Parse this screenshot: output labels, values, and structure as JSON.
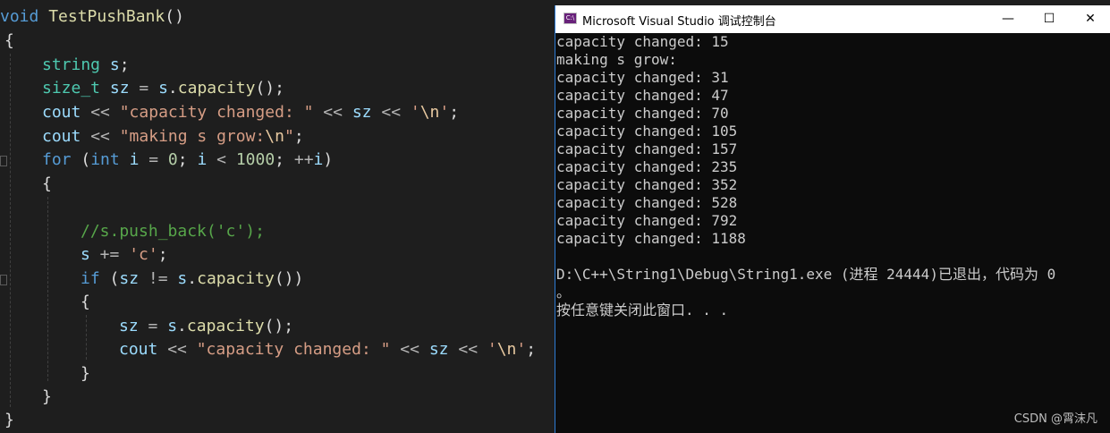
{
  "editor": {
    "lines": [
      [
        {
          "c": "kw",
          "t": "void"
        },
        {
          "c": "",
          "t": " "
        },
        {
          "c": "fn",
          "t": "TestPushBank"
        },
        {
          "c": "",
          "t": "()"
        }
      ],
      [
        {
          "c": "",
          "t": "{"
        }
      ],
      [
        {
          "c": "ty",
          "t": "string"
        },
        {
          "c": "",
          "t": " "
        },
        {
          "c": "var",
          "t": "s"
        },
        {
          "c": "",
          "t": ";"
        }
      ],
      [
        {
          "c": "ty",
          "t": "size_t"
        },
        {
          "c": "",
          "t": " "
        },
        {
          "c": "var",
          "t": "sz"
        },
        {
          "c": "op",
          "t": " = "
        },
        {
          "c": "var",
          "t": "s"
        },
        {
          "c": "",
          "t": "."
        },
        {
          "c": "fn",
          "t": "capacity"
        },
        {
          "c": "",
          "t": "();"
        }
      ],
      [
        {
          "c": "var",
          "t": "cout"
        },
        {
          "c": "op",
          "t": " << "
        },
        {
          "c": "str",
          "t": "\"capacity changed: \""
        },
        {
          "c": "op",
          "t": " << "
        },
        {
          "c": "var",
          "t": "sz"
        },
        {
          "c": "op",
          "t": " << "
        },
        {
          "c": "str",
          "t": "'"
        },
        {
          "c": "esc",
          "t": "\\n"
        },
        {
          "c": "str",
          "t": "'"
        },
        {
          "c": "",
          "t": ";"
        }
      ],
      [
        {
          "c": "var",
          "t": "cout"
        },
        {
          "c": "op",
          "t": " << "
        },
        {
          "c": "str",
          "t": "\"making s grow:"
        },
        {
          "c": "esc",
          "t": "\\n"
        },
        {
          "c": "str",
          "t": "\""
        },
        {
          "c": "",
          "t": ";"
        }
      ],
      [
        {
          "c": "kw",
          "t": "for"
        },
        {
          "c": "",
          "t": " ("
        },
        {
          "c": "kw",
          "t": "int"
        },
        {
          "c": "",
          "t": " "
        },
        {
          "c": "var",
          "t": "i"
        },
        {
          "c": "op",
          "t": " = "
        },
        {
          "c": "num",
          "t": "0"
        },
        {
          "c": "",
          "t": "; "
        },
        {
          "c": "var",
          "t": "i"
        },
        {
          "c": "op",
          "t": " < "
        },
        {
          "c": "num",
          "t": "1000"
        },
        {
          "c": "",
          "t": "; "
        },
        {
          "c": "op",
          "t": "++"
        },
        {
          "c": "var",
          "t": "i"
        },
        {
          "c": "",
          "t": ")"
        }
      ],
      [
        {
          "c": "",
          "t": "{"
        }
      ],
      [
        {
          "c": "",
          "t": ""
        }
      ],
      [
        {
          "c": "cm",
          "t": "//s.push_back('c');"
        }
      ],
      [
        {
          "c": "var",
          "t": "s"
        },
        {
          "c": "op",
          "t": " += "
        },
        {
          "c": "str",
          "t": "'c'"
        },
        {
          "c": "",
          "t": ";"
        }
      ],
      [
        {
          "c": "kw",
          "t": "if"
        },
        {
          "c": "",
          "t": " ("
        },
        {
          "c": "var",
          "t": "sz"
        },
        {
          "c": "op",
          "t": " != "
        },
        {
          "c": "var",
          "t": "s"
        },
        {
          "c": "",
          "t": "."
        },
        {
          "c": "fn",
          "t": "capacity"
        },
        {
          "c": "",
          "t": "())"
        }
      ],
      [
        {
          "c": "",
          "t": "{"
        }
      ],
      [
        {
          "c": "var",
          "t": "sz"
        },
        {
          "c": "op",
          "t": " = "
        },
        {
          "c": "var",
          "t": "s"
        },
        {
          "c": "",
          "t": "."
        },
        {
          "c": "fn",
          "t": "capacity"
        },
        {
          "c": "",
          "t": "();"
        }
      ],
      [
        {
          "c": "var",
          "t": "cout"
        },
        {
          "c": "op",
          "t": " << "
        },
        {
          "c": "str",
          "t": "\"capacity changed: \""
        },
        {
          "c": "op",
          "t": " << "
        },
        {
          "c": "var",
          "t": "sz"
        },
        {
          "c": "op",
          "t": " << "
        },
        {
          "c": "str",
          "t": "'"
        },
        {
          "c": "esc",
          "t": "\\n"
        },
        {
          "c": "str",
          "t": "'"
        },
        {
          "c": "",
          "t": ";"
        }
      ],
      [
        {
          "c": "",
          "t": "}"
        }
      ],
      [
        {
          "c": "",
          "t": "}"
        }
      ],
      [
        {
          "c": "",
          "t": "}"
        }
      ]
    ]
  },
  "console": {
    "icon_label": "C:\\",
    "title": "Microsoft Visual Studio 调试控制台",
    "minimize": "—",
    "maximize": "☐",
    "close": "✕",
    "lines": [
      "capacity changed: 15",
      "making s grow:",
      "capacity changed: 31",
      "capacity changed: 47",
      "capacity changed: 70",
      "capacity changed: 105",
      "capacity changed: 157",
      "capacity changed: 235",
      "capacity changed: 352",
      "capacity changed: 528",
      "capacity changed: 792",
      "capacity changed: 1188",
      "",
      "D:\\C++\\String1\\Debug\\String1.exe (进程 24444)已退出，代码为 0",
      "。",
      "按任意键关闭此窗口. . ."
    ]
  },
  "watermark": "CSDN @霄沫凡"
}
